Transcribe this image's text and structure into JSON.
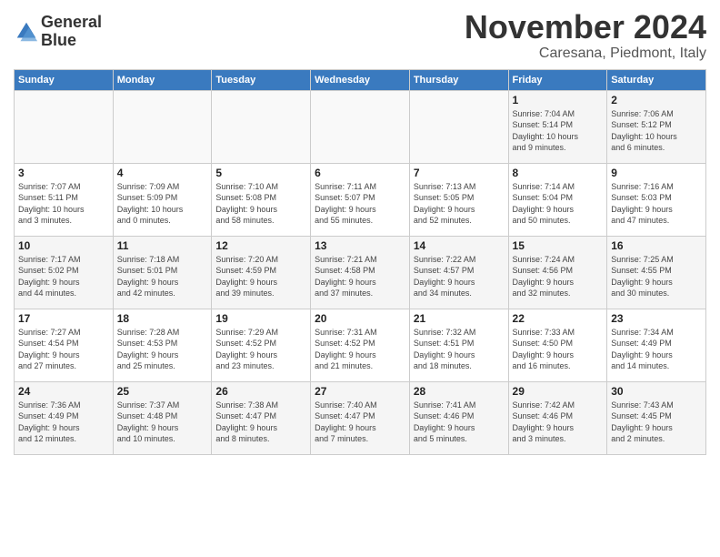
{
  "header": {
    "logo_text_line1": "General",
    "logo_text_line2": "Blue",
    "month_title": "November 2024",
    "subtitle": "Caresana, Piedmont, Italy"
  },
  "weekdays": [
    "Sunday",
    "Monday",
    "Tuesday",
    "Wednesday",
    "Thursday",
    "Friday",
    "Saturday"
  ],
  "weeks": [
    [
      {
        "day": "",
        "info": ""
      },
      {
        "day": "",
        "info": ""
      },
      {
        "day": "",
        "info": ""
      },
      {
        "day": "",
        "info": ""
      },
      {
        "day": "",
        "info": ""
      },
      {
        "day": "1",
        "info": "Sunrise: 7:04 AM\nSunset: 5:14 PM\nDaylight: 10 hours\nand 9 minutes."
      },
      {
        "day": "2",
        "info": "Sunrise: 7:06 AM\nSunset: 5:12 PM\nDaylight: 10 hours\nand 6 minutes."
      }
    ],
    [
      {
        "day": "3",
        "info": "Sunrise: 7:07 AM\nSunset: 5:11 PM\nDaylight: 10 hours\nand 3 minutes."
      },
      {
        "day": "4",
        "info": "Sunrise: 7:09 AM\nSunset: 5:09 PM\nDaylight: 10 hours\nand 0 minutes."
      },
      {
        "day": "5",
        "info": "Sunrise: 7:10 AM\nSunset: 5:08 PM\nDaylight: 9 hours\nand 58 minutes."
      },
      {
        "day": "6",
        "info": "Sunrise: 7:11 AM\nSunset: 5:07 PM\nDaylight: 9 hours\nand 55 minutes."
      },
      {
        "day": "7",
        "info": "Sunrise: 7:13 AM\nSunset: 5:05 PM\nDaylight: 9 hours\nand 52 minutes."
      },
      {
        "day": "8",
        "info": "Sunrise: 7:14 AM\nSunset: 5:04 PM\nDaylight: 9 hours\nand 50 minutes."
      },
      {
        "day": "9",
        "info": "Sunrise: 7:16 AM\nSunset: 5:03 PM\nDaylight: 9 hours\nand 47 minutes."
      }
    ],
    [
      {
        "day": "10",
        "info": "Sunrise: 7:17 AM\nSunset: 5:02 PM\nDaylight: 9 hours\nand 44 minutes."
      },
      {
        "day": "11",
        "info": "Sunrise: 7:18 AM\nSunset: 5:01 PM\nDaylight: 9 hours\nand 42 minutes."
      },
      {
        "day": "12",
        "info": "Sunrise: 7:20 AM\nSunset: 4:59 PM\nDaylight: 9 hours\nand 39 minutes."
      },
      {
        "day": "13",
        "info": "Sunrise: 7:21 AM\nSunset: 4:58 PM\nDaylight: 9 hours\nand 37 minutes."
      },
      {
        "day": "14",
        "info": "Sunrise: 7:22 AM\nSunset: 4:57 PM\nDaylight: 9 hours\nand 34 minutes."
      },
      {
        "day": "15",
        "info": "Sunrise: 7:24 AM\nSunset: 4:56 PM\nDaylight: 9 hours\nand 32 minutes."
      },
      {
        "day": "16",
        "info": "Sunrise: 7:25 AM\nSunset: 4:55 PM\nDaylight: 9 hours\nand 30 minutes."
      }
    ],
    [
      {
        "day": "17",
        "info": "Sunrise: 7:27 AM\nSunset: 4:54 PM\nDaylight: 9 hours\nand 27 minutes."
      },
      {
        "day": "18",
        "info": "Sunrise: 7:28 AM\nSunset: 4:53 PM\nDaylight: 9 hours\nand 25 minutes."
      },
      {
        "day": "19",
        "info": "Sunrise: 7:29 AM\nSunset: 4:52 PM\nDaylight: 9 hours\nand 23 minutes."
      },
      {
        "day": "20",
        "info": "Sunrise: 7:31 AM\nSunset: 4:52 PM\nDaylight: 9 hours\nand 21 minutes."
      },
      {
        "day": "21",
        "info": "Sunrise: 7:32 AM\nSunset: 4:51 PM\nDaylight: 9 hours\nand 18 minutes."
      },
      {
        "day": "22",
        "info": "Sunrise: 7:33 AM\nSunset: 4:50 PM\nDaylight: 9 hours\nand 16 minutes."
      },
      {
        "day": "23",
        "info": "Sunrise: 7:34 AM\nSunset: 4:49 PM\nDaylight: 9 hours\nand 14 minutes."
      }
    ],
    [
      {
        "day": "24",
        "info": "Sunrise: 7:36 AM\nSunset: 4:49 PM\nDaylight: 9 hours\nand 12 minutes."
      },
      {
        "day": "25",
        "info": "Sunrise: 7:37 AM\nSunset: 4:48 PM\nDaylight: 9 hours\nand 10 minutes."
      },
      {
        "day": "26",
        "info": "Sunrise: 7:38 AM\nSunset: 4:47 PM\nDaylight: 9 hours\nand 8 minutes."
      },
      {
        "day": "27",
        "info": "Sunrise: 7:40 AM\nSunset: 4:47 PM\nDaylight: 9 hours\nand 7 minutes."
      },
      {
        "day": "28",
        "info": "Sunrise: 7:41 AM\nSunset: 4:46 PM\nDaylight: 9 hours\nand 5 minutes."
      },
      {
        "day": "29",
        "info": "Sunrise: 7:42 AM\nSunset: 4:46 PM\nDaylight: 9 hours\nand 3 minutes."
      },
      {
        "day": "30",
        "info": "Sunrise: 7:43 AM\nSunset: 4:45 PM\nDaylight: 9 hours\nand 2 minutes."
      }
    ]
  ]
}
